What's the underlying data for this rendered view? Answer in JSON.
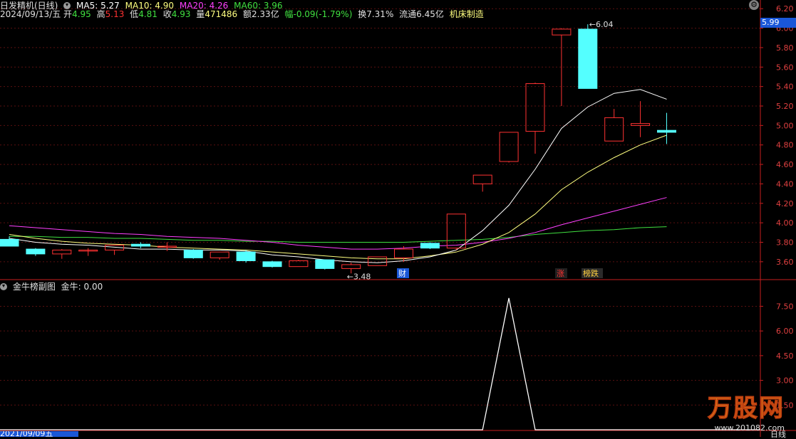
{
  "header": {
    "stock_name": "日发精机(日线)",
    "ma5_label": "MA5: 5.27",
    "ma10_label": "MA10: 4.90",
    "ma20_label": "MA20: 4.26",
    "ma60_label": "MA60: 3.96",
    "date": "2024/09/13/五",
    "open_label": "开",
    "open": "4.95",
    "high_label": "高",
    "high": "5.13",
    "low_label": "低",
    "low": "4.81",
    "close_label": "收",
    "close": "4.93",
    "volume_label": "量",
    "volume": "471486",
    "amount": "额2.33亿",
    "change": "幅-0.09(-1.79%)",
    "turnover": "换7.31%",
    "float_cap": "流通6.45亿",
    "industry": "机床制造"
  },
  "sub_panel": {
    "name": "金牛榜副图",
    "value_label": "金牛: 0.00"
  },
  "current_price_tag": "5.99",
  "annotations": {
    "high_mark": "6.04",
    "low_mark": "3.48",
    "event_cai": "财",
    "event_zhang": "涨",
    "event_bang": "榜跌"
  },
  "bottom_date": "2021/09/09五",
  "bottom_right": "日线",
  "watermark": {
    "logo_text": "万股网",
    "url": "www.201082.com"
  },
  "colors": {
    "up": "#ff3232",
    "down": "#54ffff",
    "ma5": "#ffffff",
    "ma10": "#ffff80",
    "ma20": "#ff40ff",
    "ma60": "#40e040",
    "axis": "#c81e1e",
    "grid": "#5a1010"
  },
  "chart_data": {
    "type": "candlestick",
    "y_ticks_main": [
      "6.20",
      "6.00",
      "5.80",
      "5.60",
      "5.40",
      "5.20",
      "5.00",
      "4.80",
      "4.60",
      "4.40",
      "4.20",
      "4.00",
      "3.80",
      "3.60"
    ],
    "y_ticks_sub": [
      "7.50",
      "6.00",
      "4.50",
      "3.00",
      "1.50"
    ],
    "ylim_main": [
      3.46,
      6.26
    ],
    "ylim_sub": [
      0,
      8.6
    ],
    "candles": [
      {
        "o": 3.83,
        "h": 3.86,
        "l": 3.76,
        "c": 3.76
      },
      {
        "o": 3.73,
        "h": 3.74,
        "l": 3.66,
        "c": 3.68
      },
      {
        "o": 3.68,
        "h": 3.73,
        "l": 3.63,
        "c": 3.72
      },
      {
        "o": 3.72,
        "h": 3.74,
        "l": 3.66,
        "c": 3.72
      },
      {
        "o": 3.72,
        "h": 3.77,
        "l": 3.67,
        "c": 3.77
      },
      {
        "o": 3.78,
        "h": 3.8,
        "l": 3.74,
        "c": 3.76
      },
      {
        "o": 3.76,
        "h": 3.8,
        "l": 3.71,
        "c": 3.76
      },
      {
        "o": 3.72,
        "h": 3.73,
        "l": 3.63,
        "c": 3.64
      },
      {
        "o": 3.64,
        "h": 3.7,
        "l": 3.62,
        "c": 3.7
      },
      {
        "o": 3.7,
        "h": 3.72,
        "l": 3.59,
        "c": 3.61
      },
      {
        "o": 3.6,
        "h": 3.61,
        "l": 3.54,
        "c": 3.55
      },
      {
        "o": 3.55,
        "h": 3.62,
        "l": 3.55,
        "c": 3.61
      },
      {
        "o": 3.62,
        "h": 3.62,
        "l": 3.52,
        "c": 3.53
      },
      {
        "o": 3.53,
        "h": 3.59,
        "l": 3.48,
        "c": 3.57
      },
      {
        "o": 3.56,
        "h": 3.65,
        "l": 3.56,
        "c": 3.65
      },
      {
        "o": 3.64,
        "h": 3.76,
        "l": 3.6,
        "c": 3.73
      },
      {
        "o": 3.79,
        "h": 3.8,
        "l": 3.73,
        "c": 3.74
      },
      {
        "o": 3.74,
        "h": 4.09,
        "l": 3.72,
        "c": 4.09
      },
      {
        "o": 4.4,
        "h": 4.49,
        "l": 4.32,
        "c": 4.49
      },
      {
        "o": 4.63,
        "h": 4.93,
        "l": 4.62,
        "c": 4.93
      },
      {
        "o": 4.94,
        "h": 5.44,
        "l": 4.71,
        "c": 5.43
      },
      {
        "o": 5.93,
        "h": 6.0,
        "l": 5.2,
        "c": 5.99
      },
      {
        "o": 5.99,
        "h": 6.04,
        "l": 5.38,
        "c": 5.38
      },
      {
        "o": 4.84,
        "h": 5.17,
        "l": 4.84,
        "c": 5.08
      },
      {
        "o": 5.0,
        "h": 5.25,
        "l": 4.88,
        "c": 5.02
      },
      {
        "o": 4.95,
        "h": 5.13,
        "l": 4.81,
        "c": 4.93
      }
    ],
    "ma5": [
      3.84,
      3.8,
      3.78,
      3.77,
      3.75,
      3.73,
      3.73,
      3.72,
      3.72,
      3.71,
      3.67,
      3.65,
      3.62,
      3.6,
      3.59,
      3.61,
      3.65,
      3.72,
      3.92,
      4.18,
      4.55,
      4.97,
      5.19,
      5.33,
      5.37,
      5.27
    ],
    "ma10": [
      3.88,
      3.84,
      3.81,
      3.79,
      3.78,
      3.77,
      3.75,
      3.74,
      3.73,
      3.72,
      3.7,
      3.68,
      3.66,
      3.64,
      3.63,
      3.63,
      3.66,
      3.7,
      3.78,
      3.9,
      4.09,
      4.34,
      4.52,
      4.67,
      4.8,
      4.9
    ],
    "ma20": [
      3.97,
      3.95,
      3.93,
      3.91,
      3.89,
      3.88,
      3.86,
      3.85,
      3.84,
      3.82,
      3.8,
      3.77,
      3.75,
      3.73,
      3.73,
      3.74,
      3.76,
      3.77,
      3.8,
      3.84,
      3.9,
      3.98,
      4.05,
      4.12,
      4.19,
      4.26
    ],
    "ma60": [
      3.86,
      3.86,
      3.85,
      3.85,
      3.84,
      3.84,
      3.83,
      3.82,
      3.82,
      3.81,
      3.81,
      3.8,
      3.8,
      3.8,
      3.8,
      3.8,
      3.81,
      3.82,
      3.83,
      3.85,
      3.88,
      3.9,
      3.92,
      3.93,
      3.95,
      3.96
    ],
    "jinniu": [
      0,
      0,
      0,
      0,
      0,
      0,
      0,
      0,
      0,
      0,
      0,
      0,
      0,
      0,
      0,
      0,
      0,
      0,
      0,
      8,
      0,
      0,
      0,
      0,
      0,
      0
    ]
  }
}
